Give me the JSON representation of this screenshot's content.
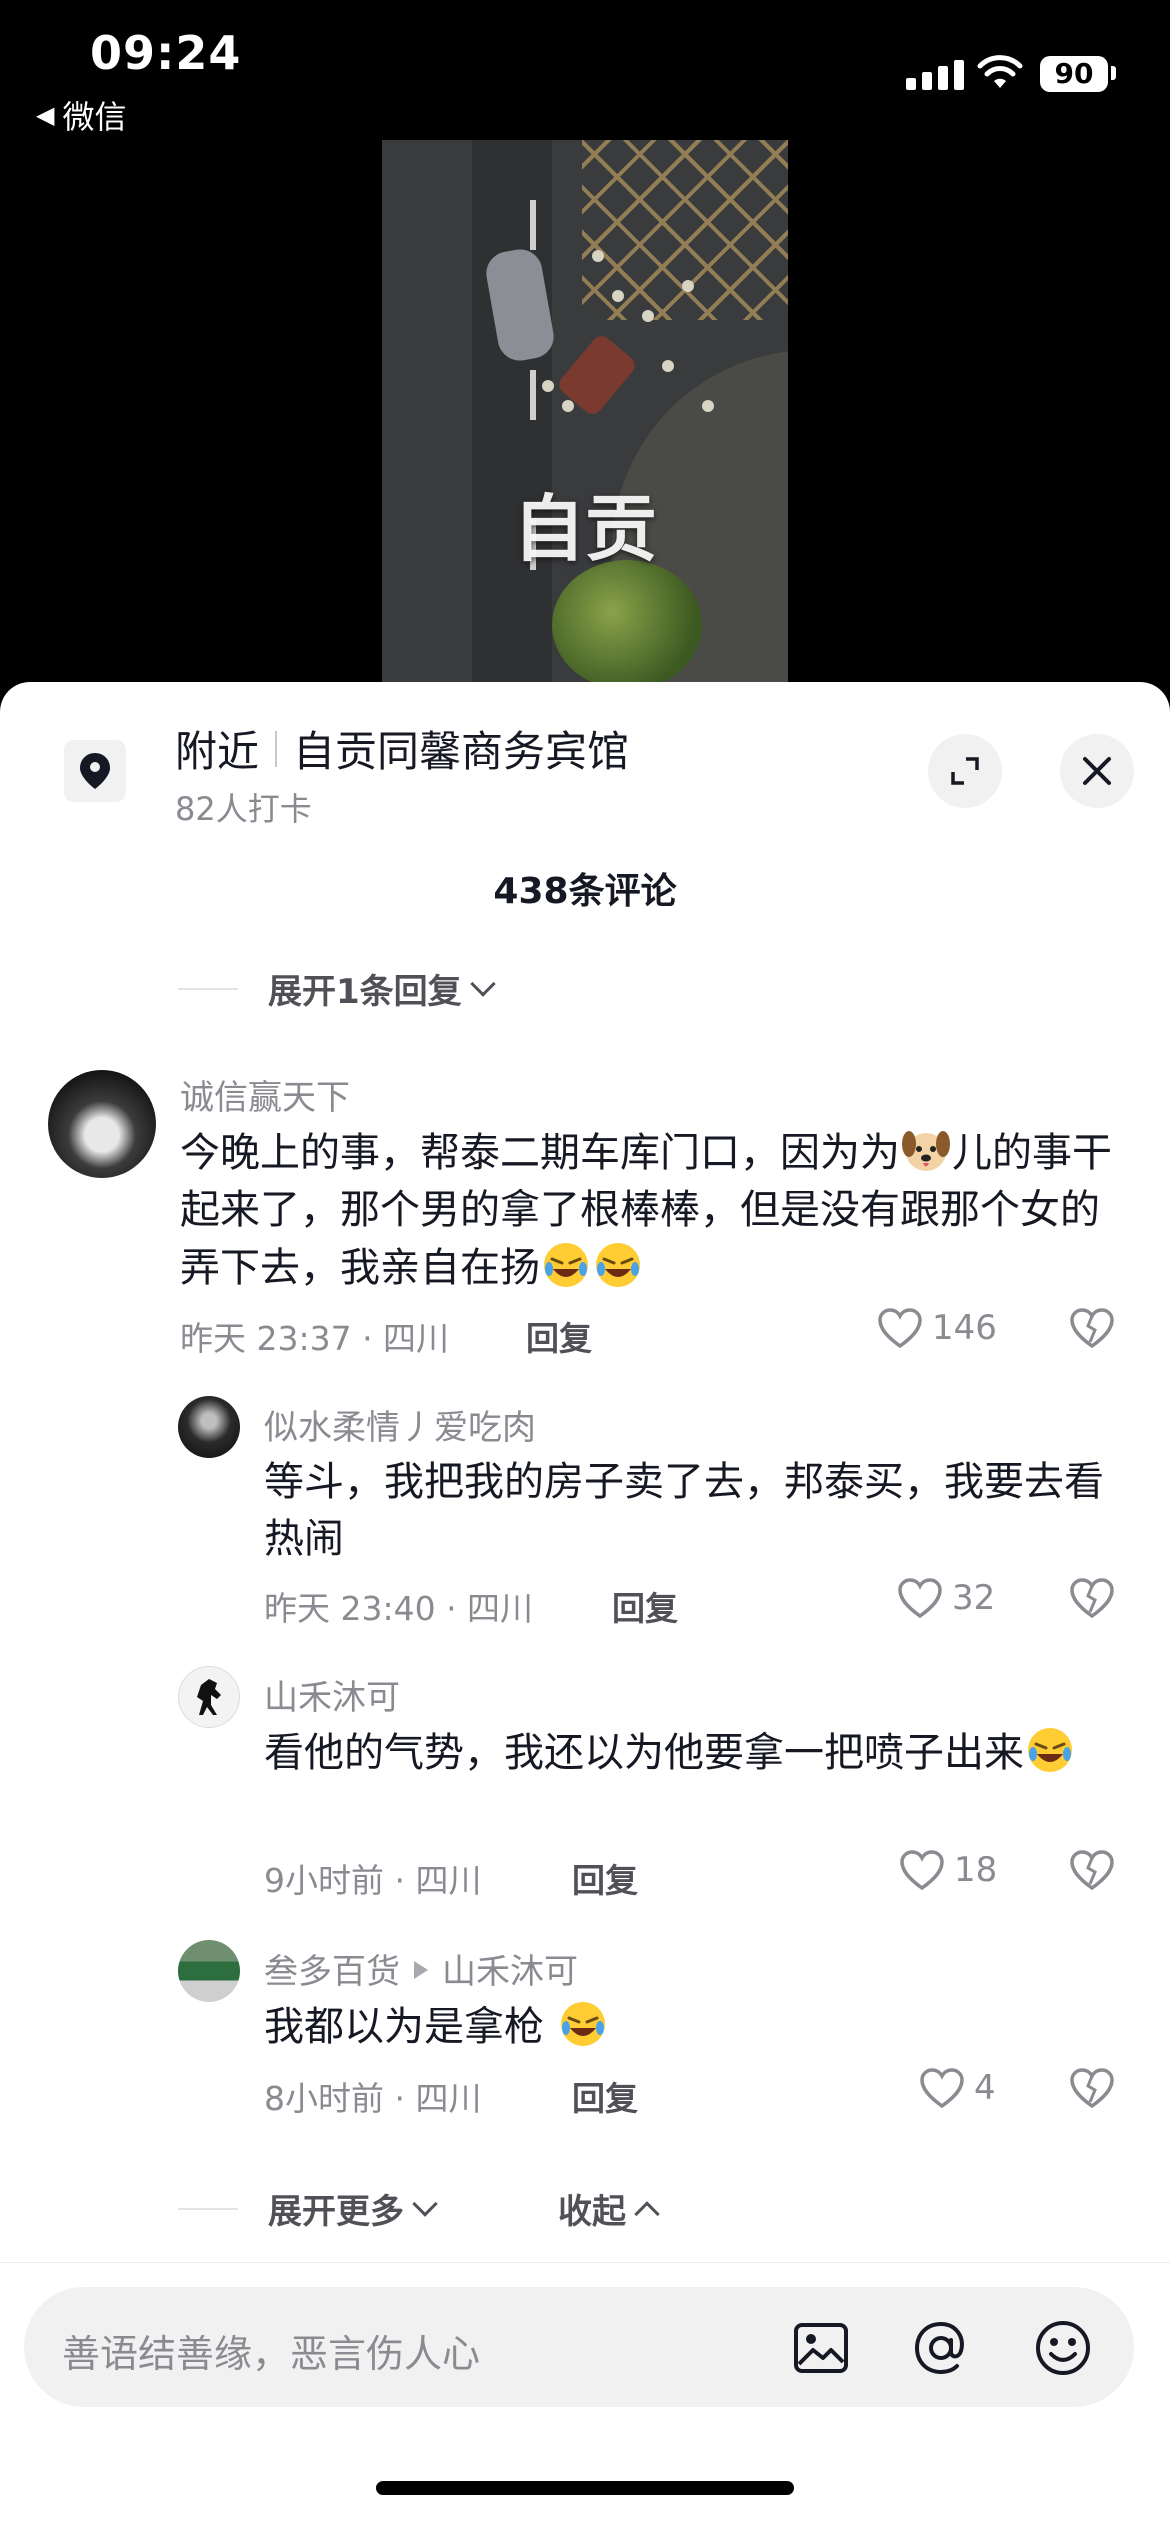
{
  "status_bar": {
    "time": "09:24",
    "back_app": "微信",
    "battery": "90"
  },
  "video": {
    "caption": "自贡"
  },
  "location": {
    "label": "附近",
    "name": "自贡同馨商务宾馆",
    "checkins": "82人打卡"
  },
  "comments_header": {
    "count_label": "438条评论"
  },
  "top_expand": {
    "label": "展开1条回复"
  },
  "main_comment": {
    "author": "诚信赢天下",
    "text_1": "今晚上的事，帮泰二期车库门口，因为为",
    "text_2": "儿的事干起来了，那个男的拿了根棒棒，但是没有跟那个女的弄下去，我亲自在扬",
    "meta": "昨天 23:37 · 四川",
    "reply_label": "回复",
    "likes": "146"
  },
  "replies": [
    {
      "author": "似水柔情丿爱吃肉",
      "text": "等斗，我把我的房子卖了去，邦泰买，我要去看热闹",
      "meta": "昨天 23:40 · 四川",
      "reply_label": "回复",
      "likes": "32"
    },
    {
      "author": "山禾沐可",
      "text": "看他的气势，我还以为他要拿一把喷子出来",
      "meta": "9小时前 · 四川",
      "reply_label": "回复",
      "likes": "18"
    },
    {
      "author": "叁多百货",
      "reply_to": "山禾沐可",
      "text": "我都以为是拿枪",
      "meta": "8小时前 · 四川",
      "reply_label": "回复",
      "likes": "4"
    }
  ],
  "thread_actions": {
    "expand_more": "展开更多",
    "collapse": "收起"
  },
  "input": {
    "placeholder": "善语结善缘，恶言伤人心"
  },
  "icons": {
    "location": "location-pin-icon",
    "expand": "expand-icon",
    "close": "close-icon",
    "like": "heart-icon",
    "dislike": "broken-heart-icon",
    "image": "image-icon",
    "mention": "at-icon",
    "emoji": "emoji-icon",
    "dog_emoji": "dog-face-emoji",
    "laugh_emoji": "rolling-laughing-emoji"
  }
}
